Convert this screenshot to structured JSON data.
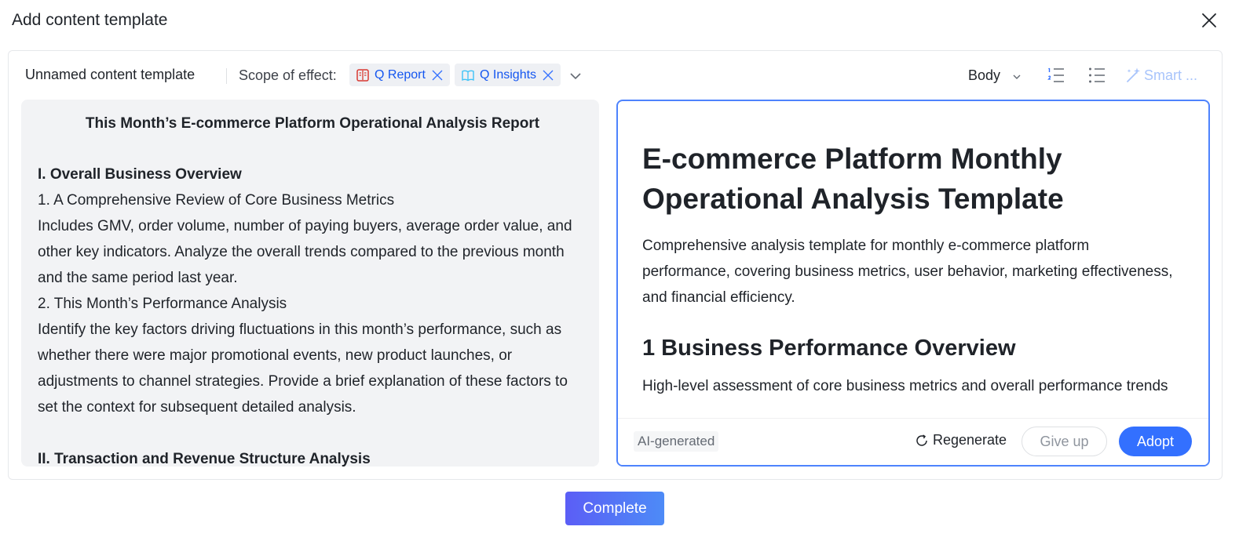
{
  "dialog": {
    "title": "Add content template",
    "complete_label": "Complete"
  },
  "toolbar": {
    "template_name": "Unnamed content template",
    "scope_label": "Scope of effect:",
    "tags": [
      {
        "label": "Q Report",
        "icon": "report-icon",
        "color": "#d83931"
      },
      {
        "label": "Q Insights",
        "icon": "insights-icon",
        "color": "#3ec3f7"
      }
    ],
    "style_select": "Body",
    "smart_label": "Smart ..."
  },
  "source": {
    "title": "This Month’s E-commerce Platform Operational Analysis Report",
    "section1_heading": "I. Overall Business Overview",
    "item1_heading": "1. A Comprehensive Review of Core Business Metrics",
    "item1_body": "Includes GMV, order volume, number of paying buyers, average order value, and other key indicators. Analyze the overall trends compared to the previous month and the same period last year.",
    "item2_heading": "2. This Month’s Performance Analysis",
    "item2_body": "Identify the key factors driving fluctuations in this month’s performance, such as whether there were major promotional events, new product launches, or adjustments to channel strategies. Provide a brief explanation of these factors to set the context for subsequent detailed analysis.",
    "section2_heading": "II. Transaction and Revenue Structure Analysis"
  },
  "ai": {
    "title": "E-commerce Platform Monthly Operational Analysis Template",
    "description": "Comprehensive analysis template for monthly e-commerce platform performance, covering business metrics, user behavior, marketing effectiveness, and financial efficiency.",
    "section_heading": "1 Business Performance Overview",
    "section_desc": "High-level assessment of core business metrics and overall performance trends",
    "badge": "AI-generated",
    "regenerate_label": "Regenerate",
    "giveup_label": "Give up",
    "adopt_label": "Adopt"
  },
  "colors": {
    "accent": "#3370ff",
    "tag_text": "#1456f0",
    "ai_border": "#4e83fd",
    "source_bg": "#f2f3f5"
  }
}
